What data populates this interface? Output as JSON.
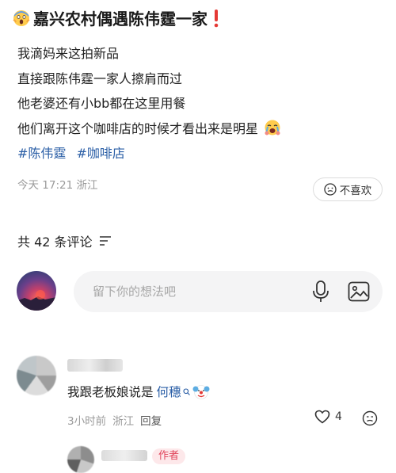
{
  "post": {
    "title": "嘉兴农村偶遇陈伟霆一家",
    "title_emoji": "scream-emoji",
    "title_mark": "exclamation-icon",
    "lines": [
      "我滴妈来这拍新品",
      "直接跟陈伟霆一家人擦肩而过",
      "他老婆还有小bb都在这里用餐",
      "他们离开这个咖啡店的时候才看出来是明星"
    ],
    "last_line_emoji": "crying-emoji",
    "tags": [
      "#陈伟霆",
      "#咖啡店"
    ],
    "meta": "今天 17:21 浙江",
    "dislike_label": "不喜欢"
  },
  "comments_section": {
    "header": "共 42 条评论",
    "input_placeholder": "留下你的想法吧"
  },
  "comment": {
    "text": "我跟老板娘说是",
    "link": "何穗",
    "meta_time": "3小时前",
    "meta_loc": "浙江",
    "reply_label": "回复",
    "likes": "4"
  },
  "reply": {
    "author_badge": "作者"
  },
  "colors": {
    "tag": "#2a5ea6",
    "badge_bg": "#fde8ea",
    "badge_text": "#e0455b",
    "alert": "#e53935"
  }
}
